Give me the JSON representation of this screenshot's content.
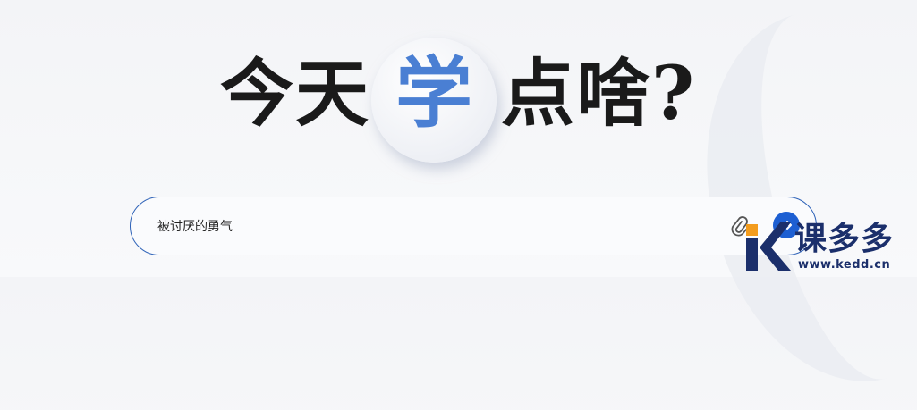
{
  "hero": {
    "text_left": "今天",
    "text_highlight": "学",
    "text_right": "点啥?"
  },
  "search": {
    "value": "被讨厌的勇气"
  },
  "icons": {
    "attach": "paperclip-icon",
    "send": "arrow-right-icon"
  },
  "watermark": {
    "name": "课多多",
    "url": "www.kedd.cn"
  },
  "colors": {
    "accent": "#4a7fd3",
    "send_button": "#1d5fd2",
    "search_border": "#2f63b8",
    "watermark_orange": "#f39c1e",
    "watermark_navy": "#1b2f6b"
  }
}
